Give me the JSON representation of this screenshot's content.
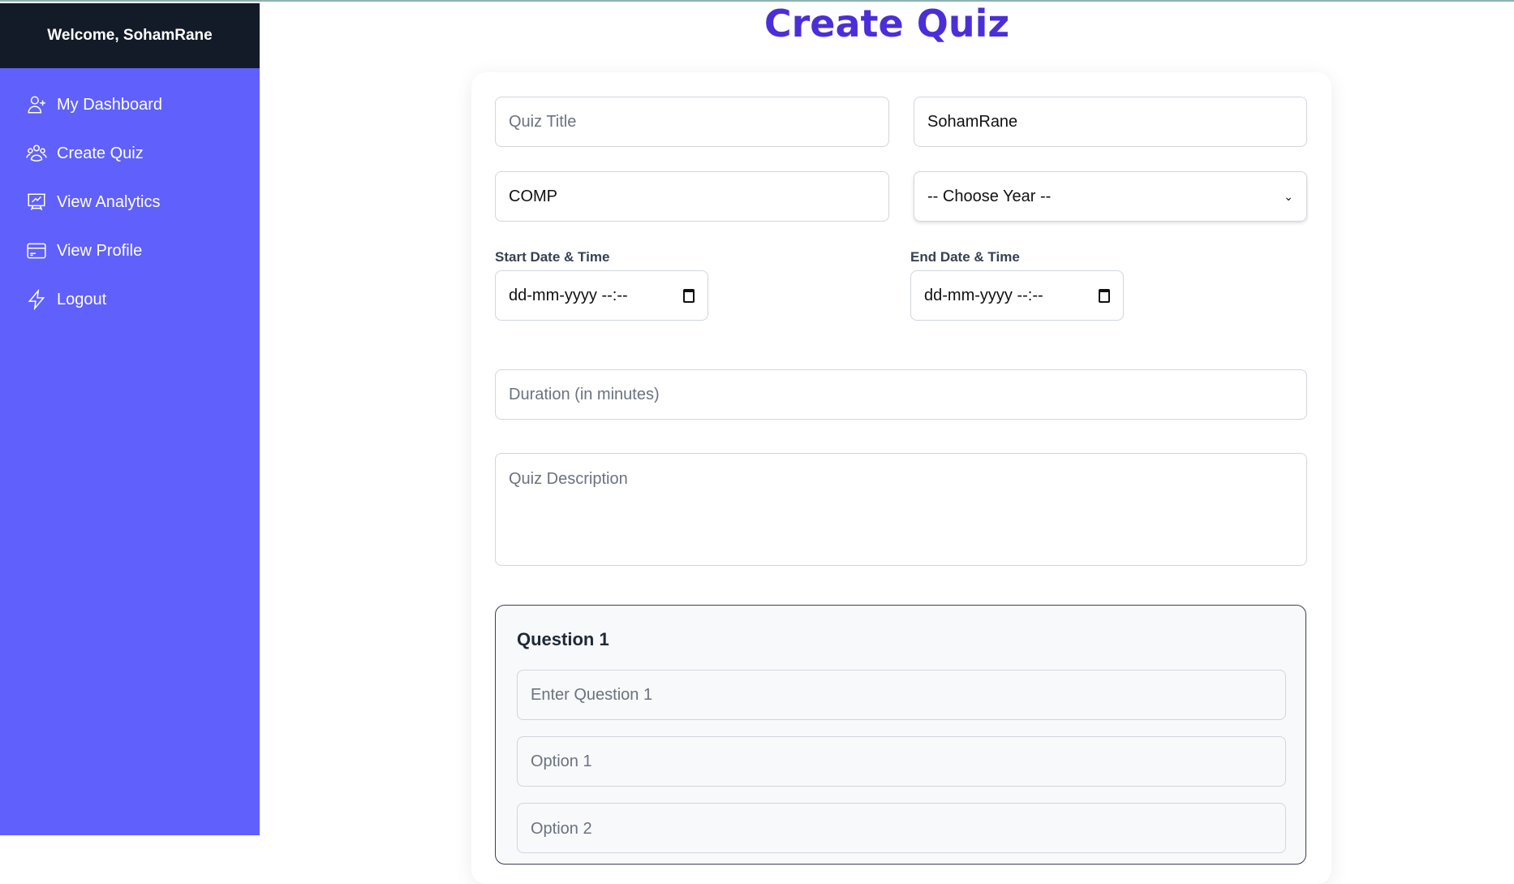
{
  "sidebar": {
    "welcome": "Welcome, SohamRane",
    "items": [
      {
        "label": "My Dashboard",
        "icon": "user-plus-icon"
      },
      {
        "label": "Create Quiz",
        "icon": "users-group-icon"
      },
      {
        "label": "View Analytics",
        "icon": "presentation-chart-icon"
      },
      {
        "label": "View Profile",
        "icon": "credit-card-icon"
      },
      {
        "label": "Logout",
        "icon": "lightning-bolt-icon"
      }
    ]
  },
  "page": {
    "title": "Create Quiz"
  },
  "form": {
    "quiz_title_placeholder": "Quiz Title",
    "teacher_value": "SohamRane",
    "department_value": "COMP",
    "year_selected": "-- Choose Year --",
    "start_label": "Start Date & Time",
    "start_value": "dd-mm-yyyy --:--",
    "end_label": "End Date & Time",
    "end_value": "dd-mm-yyyy --:--",
    "duration_placeholder": "Duration (in minutes)",
    "description_placeholder": "Quiz Description"
  },
  "question": {
    "heading": "Question 1",
    "question_placeholder": "Enter Question 1",
    "options": [
      "Option 1",
      "Option 2"
    ]
  },
  "colors": {
    "sidebar": "#6060fd",
    "sidebar_header": "#131a28",
    "title": "#4a2fd9"
  }
}
